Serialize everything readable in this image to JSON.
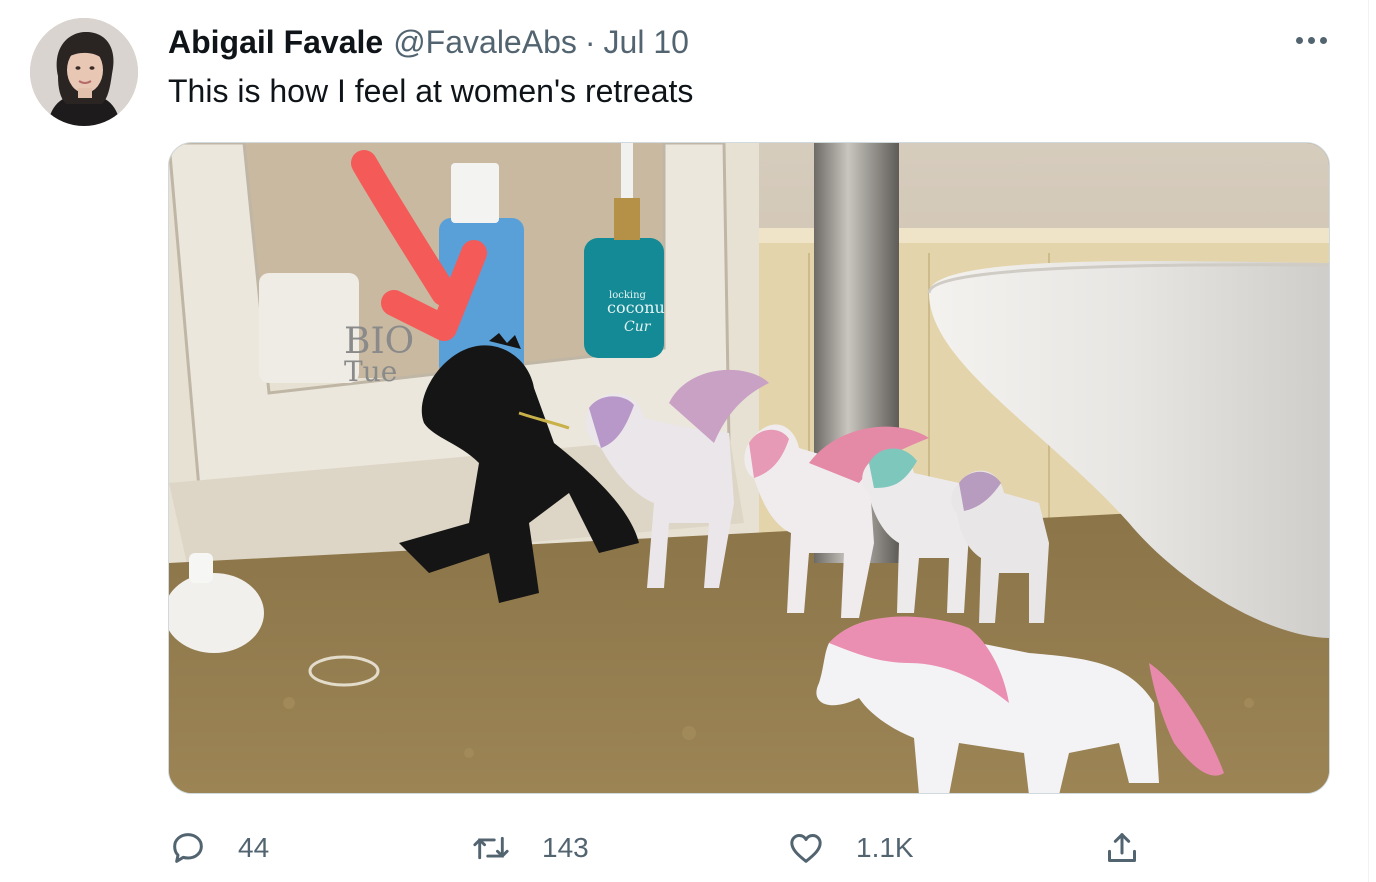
{
  "tweet": {
    "author_name": "Abigail Favale",
    "author_handle": "@FavaleAbs",
    "separator": "·",
    "date": "Jul 10",
    "text": "This is how I feel at women's retreats",
    "media": {
      "alt": "A black dinosaur toy standing among a row of white and pink unicorn and pegasus toys on a bathroom counter, with a red arrow pointing at the dinosaur",
      "label_bottle_1": "BIO",
      "label_bottle_1b": "Tue",
      "label_bottle_2": "coconu",
      "label_bottle_2b": "Cur",
      "label_bottle_2c": "locking"
    },
    "actions": {
      "reply_count": "44",
      "retweet_count": "143",
      "like_count": "1.1K"
    }
  },
  "icons": {
    "more": "more-horizontal-icon",
    "reply": "reply-bubble-icon",
    "retweet": "retweet-icon",
    "like": "heart-icon",
    "share": "share-upload-icon"
  },
  "colors": {
    "text_primary": "#0f1419",
    "text_secondary": "#536471",
    "border": "#cfd9de",
    "arrow_red": "#f45a57"
  }
}
